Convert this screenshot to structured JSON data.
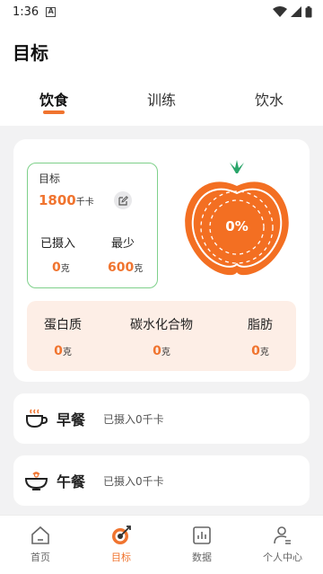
{
  "status_bar": {
    "time": "1:36",
    "notification_letter": "A"
  },
  "header": {
    "title": "目标"
  },
  "tabs": [
    {
      "label": "饮食",
      "active": true
    },
    {
      "label": "训练",
      "active": false
    },
    {
      "label": "饮水",
      "active": false
    }
  ],
  "summary": {
    "goal_label": "目标",
    "goal_value": "1800",
    "goal_unit": "千卡",
    "intake_label": "已摄入",
    "intake_value": "0",
    "intake_unit": "克",
    "min_label": "最少",
    "min_value": "600",
    "min_unit": "克",
    "progress_text": "0%",
    "progress_fraction": 0
  },
  "macros": [
    {
      "name": "蛋白质",
      "value": "0",
      "unit": "克"
    },
    {
      "name": "碳水化合物",
      "value": "0",
      "unit": "克"
    },
    {
      "name": "脂肪",
      "value": "0",
      "unit": "克"
    }
  ],
  "meals": [
    {
      "name": "早餐",
      "intake": "已摄入0千卡",
      "icon": "coffee-cup-icon"
    },
    {
      "name": "午餐",
      "intake": "已摄入0千卡",
      "icon": "rice-bowl-icon"
    }
  ],
  "bottom_nav": [
    {
      "label": "首页",
      "icon": "home-icon",
      "active": false
    },
    {
      "label": "目标",
      "icon": "target-icon",
      "active": true
    },
    {
      "label": "数据",
      "icon": "chart-icon",
      "active": false
    },
    {
      "label": "个人中心",
      "icon": "profile-icon",
      "active": false
    }
  ],
  "colors": {
    "accent": "#f0742f",
    "goal_border": "#7ed08a",
    "macro_bg": "#fdeee6",
    "leaf": "#2aa56a"
  }
}
